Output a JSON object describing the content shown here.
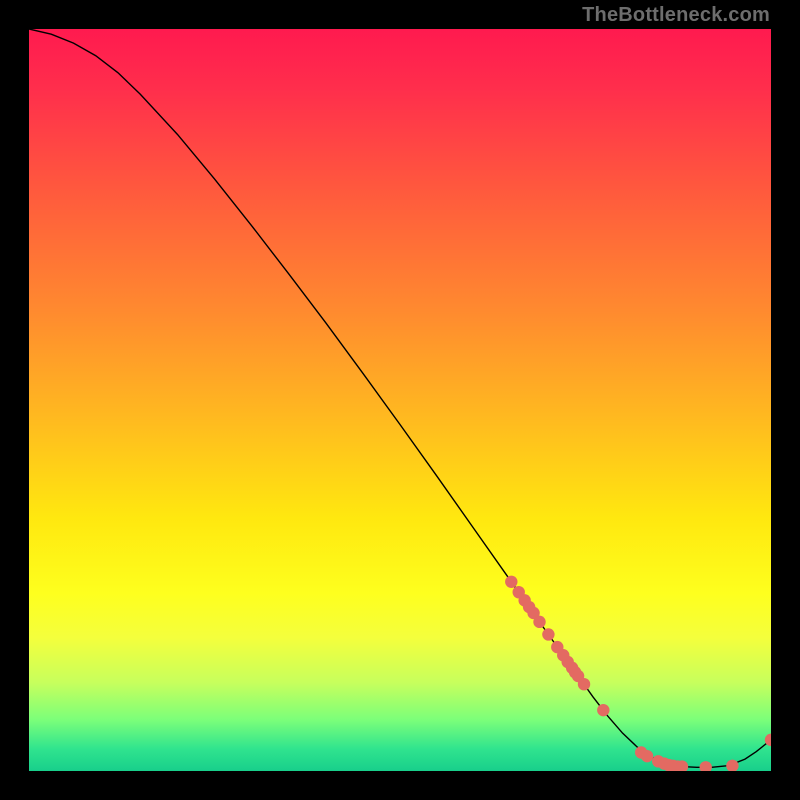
{
  "watermark": "TheBottleneck.com",
  "chart_data": {
    "type": "line",
    "title": "",
    "xlabel": "",
    "ylabel": "",
    "xlim": [
      0,
      100
    ],
    "ylim": [
      0,
      100
    ],
    "grid": false,
    "legend": false,
    "curve": {
      "name": "curve",
      "x": [
        0,
        3,
        6,
        9,
        12,
        15,
        20,
        25,
        30,
        35,
        40,
        45,
        50,
        55,
        60,
        65,
        70,
        72,
        74,
        76,
        78,
        80,
        82,
        84,
        86,
        88,
        90,
        92,
        94,
        95,
        96.5,
        98,
        100
      ],
      "y": [
        100,
        99.3,
        98.1,
        96.4,
        94.1,
        91.2,
        85.8,
        79.8,
        73.5,
        67.0,
        60.4,
        53.6,
        46.7,
        39.7,
        32.6,
        25.5,
        18.4,
        15.6,
        12.8,
        10.0,
        7.4,
        5.1,
        3.2,
        1.8,
        1.0,
        0.6,
        0.5,
        0.5,
        0.7,
        1.0,
        1.6,
        2.6,
        4.2
      ]
    },
    "points": {
      "name": "markers",
      "x": [
        65.0,
        66.0,
        66.8,
        67.4,
        68.0,
        68.8,
        70.0,
        71.2,
        72.0,
        72.6,
        73.2,
        73.6,
        74.0,
        74.8,
        77.4,
        82.5,
        83.3,
        84.8,
        85.6,
        86.2,
        86.8,
        87.4,
        88.0,
        91.2,
        94.8,
        100.0
      ],
      "y": [
        25.5,
        24.1,
        23.0,
        22.1,
        21.3,
        20.1,
        18.4,
        16.7,
        15.6,
        14.7,
        13.9,
        13.3,
        12.8,
        11.7,
        8.2,
        2.5,
        2.0,
        1.3,
        1.0,
        0.8,
        0.7,
        0.6,
        0.6,
        0.5,
        0.7,
        4.2
      ]
    }
  }
}
